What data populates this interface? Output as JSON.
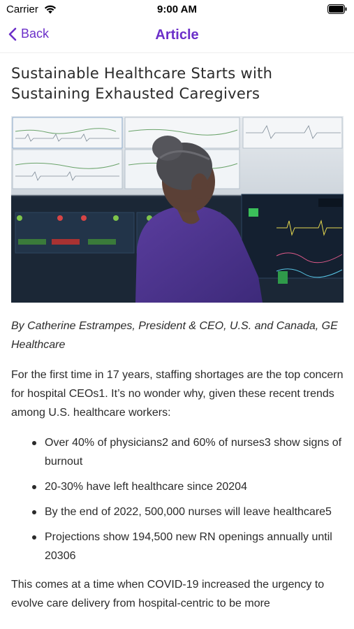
{
  "status_bar": {
    "carrier": "Carrier",
    "time": "9:00 AM",
    "icons": [
      "wifi-icon",
      "battery-icon"
    ]
  },
  "nav": {
    "back_label": "Back",
    "title": "Article",
    "accent_color": "#6b2fc9"
  },
  "article": {
    "title": "Sustainable Healthcare Starts with Sustaining Exhausted Caregivers",
    "byline": "By Catherine Estrampes, President & CEO, U.S. and Canada, GE Healthcare",
    "intro": "For the first time in 17 years, staffing shortages are the top concern for hospital CEOs1. It’s no wonder why, given these recent trends among U.S. healthcare workers:",
    "bullets": [
      "Over 40% of physicians2 and 60% of nurses3 show signs of burnout",
      "20-30% have left healthcare since 20204",
      "By the end of 2022, 500,000 nurses will leave healthcare5",
      "Projections show 194,500 new RN openings annually until 20306"
    ],
    "closing": "This comes at a time when COVID-19 increased the urgency to evolve care delivery from hospital-centric to be more"
  }
}
